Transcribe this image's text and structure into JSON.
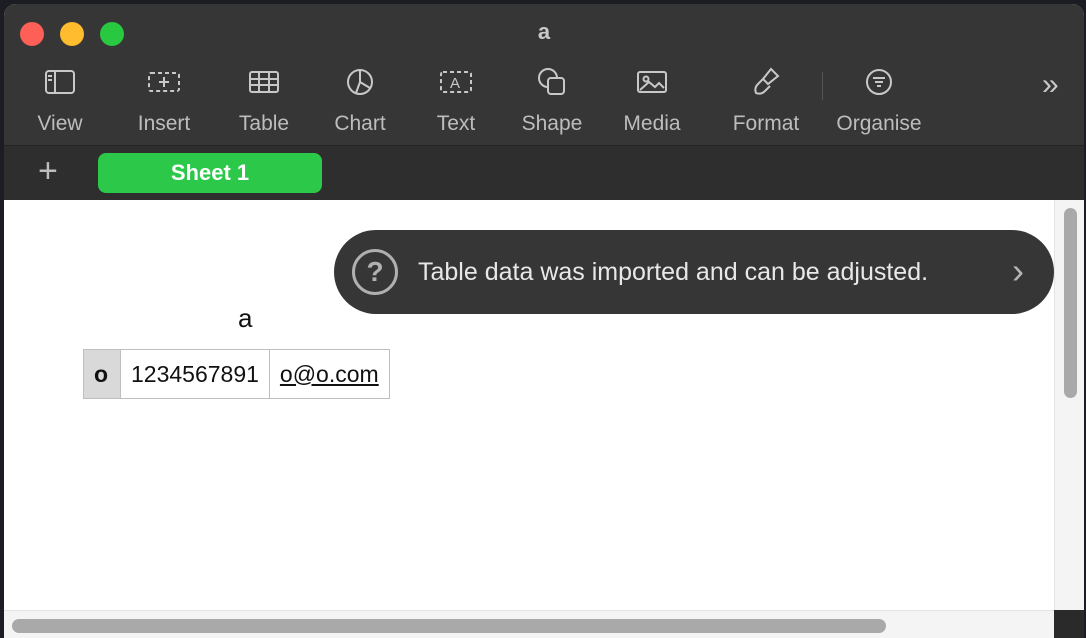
{
  "window": {
    "title": "a"
  },
  "toolbar": {
    "items": [
      {
        "label": "View",
        "icon": "sidebar-icon"
      },
      {
        "label": "Insert",
        "icon": "insert-icon"
      },
      {
        "label": "Table",
        "icon": "table-icon"
      },
      {
        "label": "Chart",
        "icon": "chart-icon"
      },
      {
        "label": "Text",
        "icon": "text-icon"
      },
      {
        "label": "Shape",
        "icon": "shape-icon"
      },
      {
        "label": "Media",
        "icon": "media-icon"
      },
      {
        "label": "Format",
        "icon": "format-brush-icon"
      },
      {
        "label": "Organise",
        "icon": "organise-icon"
      }
    ],
    "more": "»"
  },
  "tabs": {
    "add": "+",
    "sheets": [
      {
        "label": "Sheet 1",
        "active": true
      }
    ]
  },
  "table": {
    "title": "a",
    "rows": [
      [
        "o",
        "1234567891",
        "o@o.com"
      ]
    ]
  },
  "toast": {
    "message": "Table data was imported and can be adjusted.",
    "icon": "question-icon",
    "arrow": "›"
  },
  "colors": {
    "accent": "#2cc84a",
    "toolbar": "#363636"
  }
}
